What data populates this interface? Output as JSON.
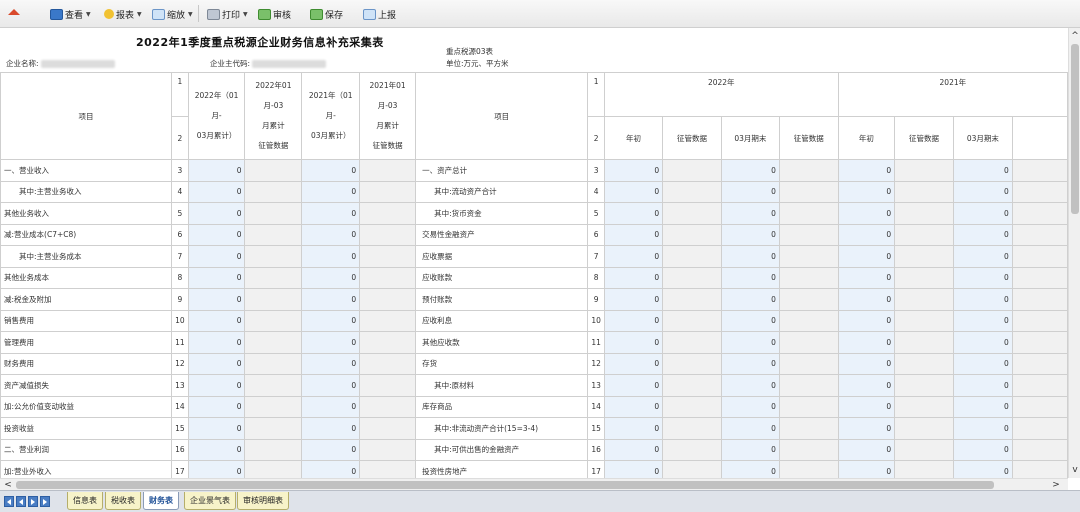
{
  "toolbar": {
    "home_label": "",
    "view_label": "查看",
    "report_label": "报表",
    "zoom_label": "缩放",
    "print_label": "打印",
    "review_label": "审核",
    "save_label": "保存",
    "upload_label": "上报"
  },
  "header": {
    "title": "2022年1季度重点税源企业财务信息补充采集表",
    "company_name_label": "企业名称:",
    "company_code_label": "企业主代码:",
    "table_code": "重点税源03表",
    "unit": "单位:万元、平方米"
  },
  "columns": {
    "item": "项目",
    "ln1": "1",
    "ln2": "2",
    "a_2022": "2022年（01月-03月累计）",
    "a_2022_1": "2022年（01月-",
    "a_2022_2": "03月累计）",
    "b_2022_1": "2022年01月-03",
    "b_2022_2": "月累计",
    "b_2022_3": "征管数据",
    "a_2021_1": "2021年（01月-",
    "a_2021_2": "03月累计）",
    "b_2021_1": "2021年01月-03",
    "b_2021_2": "月累计",
    "b_2021_3": "征管数据",
    "year_2022": "2022年",
    "year_2021": "2021年",
    "sub_begin": "年初",
    "sub_tax": "征管数据",
    "sub_end": "03月期末",
    "sub_tax2": "征管数据",
    "sub_begin2": "年初",
    "sub_tax3": "征管数据",
    "sub_end2": "03月期末"
  },
  "rows": [
    {
      "ln": "3",
      "left": "一、营业收入",
      "a": "0",
      "c": "0",
      "right": "一、资产总计",
      "r1": "0",
      "r3": "0",
      "r5": "0",
      "r7": "0"
    },
    {
      "ln": "4",
      "left": "其中:主营业务收入",
      "a": "0",
      "c": "0",
      "right": "其中:流动资产合计",
      "r1": "0",
      "r3": "0",
      "r5": "0",
      "r7": "0"
    },
    {
      "ln": "5",
      "left": "其他业务收入",
      "a": "0",
      "c": "0",
      "right": "其中:货币资金",
      "r1": "0",
      "r3": "0",
      "r5": "0",
      "r7": "0"
    },
    {
      "ln": "6",
      "left": "减:营业成本(C7+C8)",
      "a": "0",
      "c": "0",
      "right": "交易性金融资产",
      "r1": "0",
      "r3": "0",
      "r5": "0",
      "r7": "0"
    },
    {
      "ln": "7",
      "left": "其中:主营业务成本",
      "a": "0",
      "c": "0",
      "right": "应收票据",
      "r1": "0",
      "r3": "0",
      "r5": "0",
      "r7": "0"
    },
    {
      "ln": "8",
      "left": "其他业务成本",
      "a": "0",
      "c": "0",
      "right": "应收账款",
      "r1": "0",
      "r3": "0",
      "r5": "0",
      "r7": "0"
    },
    {
      "ln": "9",
      "left": "减:税金及附加",
      "a": "0",
      "c": "0",
      "right": "预付账款",
      "r1": "0",
      "r3": "0",
      "r5": "0",
      "r7": "0"
    },
    {
      "ln": "10",
      "left": "销售费用",
      "a": "0",
      "c": "0",
      "right": "应收利息",
      "r1": "0",
      "r3": "0",
      "r5": "0",
      "r7": "0"
    },
    {
      "ln": "11",
      "left": "管理费用",
      "a": "0",
      "c": "0",
      "right": "其他应收款",
      "r1": "0",
      "r3": "0",
      "r5": "0",
      "r7": "0"
    },
    {
      "ln": "12",
      "left": "财务费用",
      "a": "0",
      "c": "0",
      "right": "存货",
      "r1": "0",
      "r3": "0",
      "r5": "0",
      "r7": "0"
    },
    {
      "ln": "13",
      "left": "资产减值损失",
      "a": "0",
      "c": "0",
      "right": "其中:原材料",
      "r1": "0",
      "r3": "0",
      "r5": "0",
      "r7": "0"
    },
    {
      "ln": "14",
      "left": "加:公允价值变动收益",
      "a": "0",
      "c": "0",
      "right": "库存商品",
      "r1": "0",
      "r3": "0",
      "r5": "0",
      "r7": "0"
    },
    {
      "ln": "15",
      "left": "投资收益",
      "a": "0",
      "c": "0",
      "right": "其中:非流动资产合计(15=3-4)",
      "r1": "0",
      "r3": "0",
      "r5": "0",
      "r7": "0"
    },
    {
      "ln": "16",
      "left": "二、营业利润",
      "a": "0",
      "c": "0",
      "right": "其中:可供出售的金融资产",
      "r1": "0",
      "r3": "0",
      "r5": "0",
      "r7": "0"
    },
    {
      "ln": "17",
      "left": "加:营业外收入",
      "a": "0",
      "c": "0",
      "right": "投资性房地产",
      "r1": "0",
      "r3": "0",
      "r5": "0",
      "r7": "0"
    }
  ],
  "tabs": [
    "信息表",
    "税收表",
    "财务表",
    "企业景气表",
    "审核明细表"
  ],
  "active_tab": "财务表",
  "colors": {
    "accent": "#1d4f96",
    "blue_cell": "#eaf2fb",
    "gray_cell": "#f1f1f1",
    "tab_bg": "#f7f3c9"
  }
}
